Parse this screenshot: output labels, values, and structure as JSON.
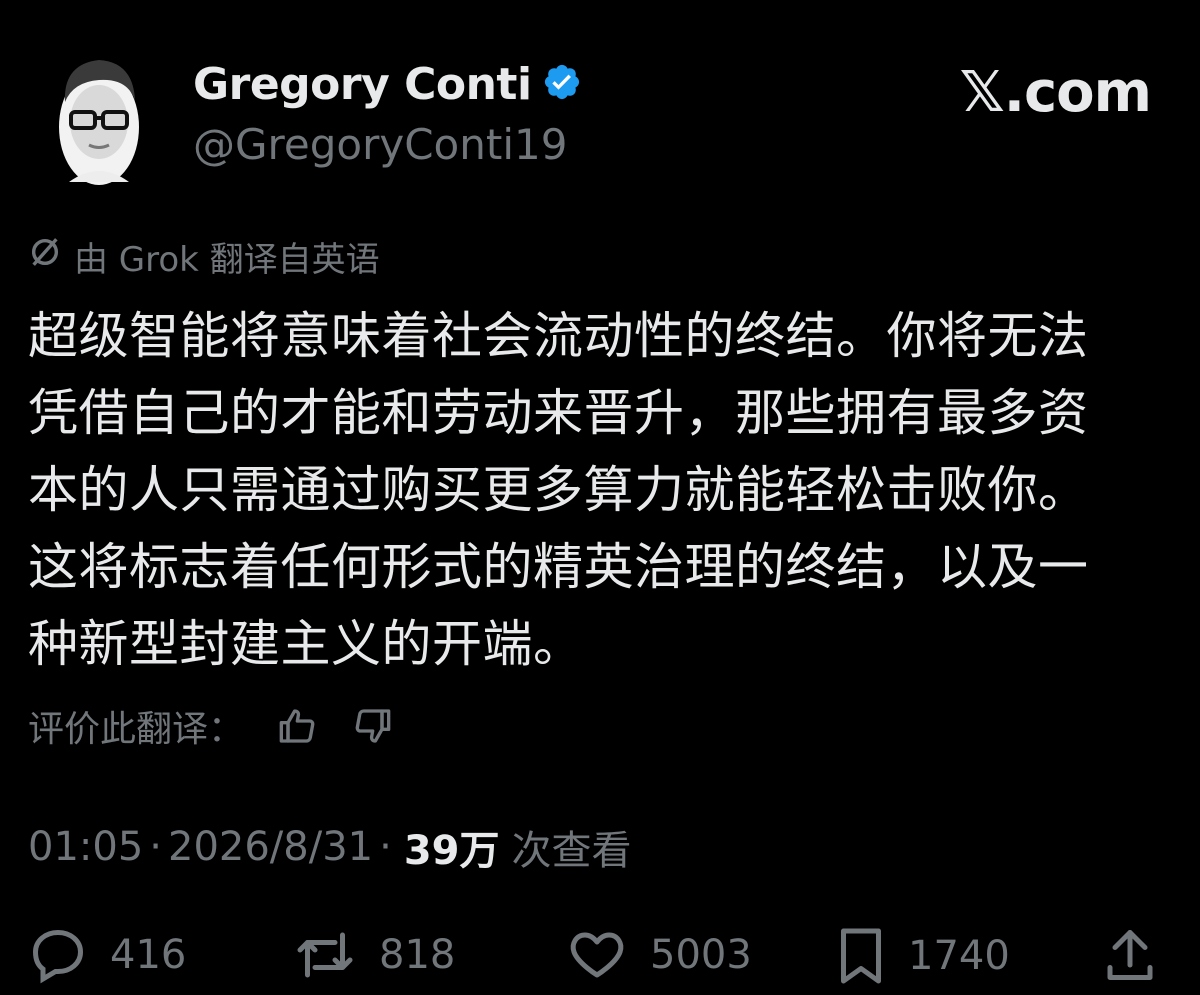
{
  "author": {
    "display_name": "Gregory Conti",
    "handle": "@GregoryConti19",
    "verified": true
  },
  "brand": "𝕏.com",
  "translation_note": {
    "icon": "grok-icon",
    "text": "由 Grok 翻译自英语"
  },
  "tweet": {
    "lines": [
      "超级智能将意味着社会流动性的终结。你将无法",
      "凭借自己的才能和劳动来晋升，那些拥有最多资",
      "本的人只需通过购买更多算力就能轻松击败你。",
      "这将标志着任何形式的精英治理的终结，以及一",
      "种新型封建主义的开端。"
    ]
  },
  "rate_translation": {
    "label": "评价此翻译：",
    "thumbs_up_icon": "thumbs-up-icon",
    "thumbs_down_icon": "thumbs-down-icon"
  },
  "meta": {
    "time": "01:05",
    "date": "2026/8/31",
    "views_count": "39万",
    "views_label": "次查看"
  },
  "actions": {
    "replies": "416",
    "reposts": "818",
    "likes": "5003",
    "bookmarks": "1740"
  },
  "colors": {
    "background": "#000000",
    "text": "#e7e9ea",
    "muted": "#71767b",
    "verified": "#1d9bf0"
  }
}
